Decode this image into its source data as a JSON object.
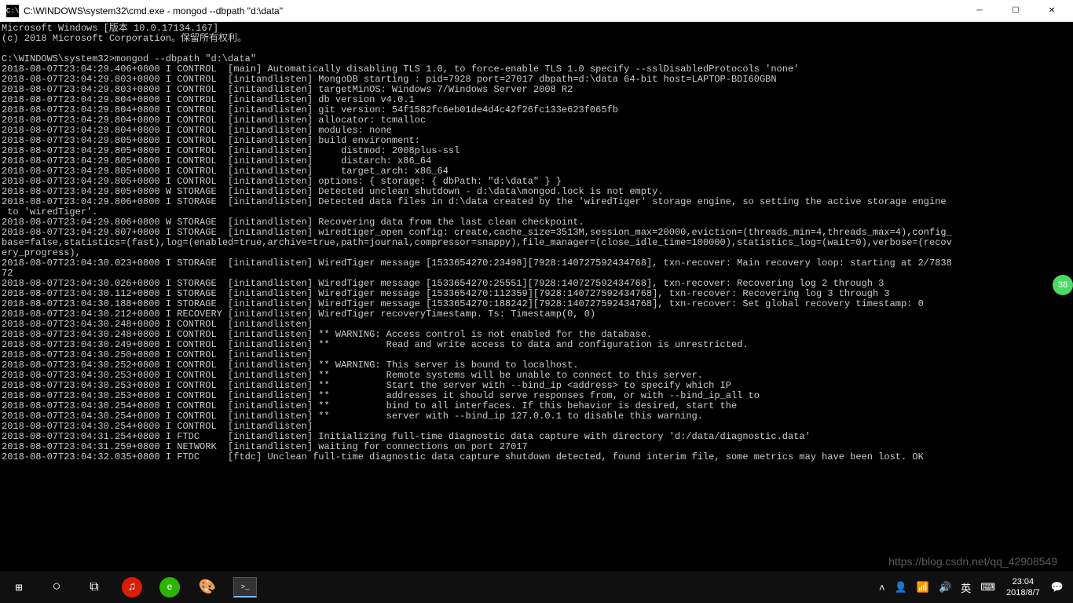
{
  "title": "C:\\WINDOWS\\system32\\cmd.exe - mongod  --dbpath \"d:\\data\"",
  "titlebar_icon": "C:\\",
  "header": [
    "Microsoft Windows [版本 10.0.17134.167]",
    "(c) 2018 Microsoft Corporation。保留所有权利。"
  ],
  "prompt": "C:\\WINDOWS\\system32>mongod --dbpath \"d:\\data\"",
  "log_lines": [
    "2018-08-07T23:04:29.406+0800 I CONTROL  [main] Automatically disabling TLS 1.0, to force-enable TLS 1.0 specify --sslDisabledProtocols 'none'",
    "2018-08-07T23:04:29.803+0800 I CONTROL  [initandlisten] MongoDB starting : pid=7928 port=27017 dbpath=d:\\data 64-bit host=LAPTOP-BDI60GBN",
    "2018-08-07T23:04:29.803+0800 I CONTROL  [initandlisten] targetMinOS: Windows 7/Windows Server 2008 R2",
    "2018-08-07T23:04:29.804+0800 I CONTROL  [initandlisten] db version v4.0.1",
    "2018-08-07T23:04:29.804+0800 I CONTROL  [initandlisten] git version: 54f1582fc6eb01de4d4c42f26fc133e623f065fb",
    "2018-08-07T23:04:29.804+0800 I CONTROL  [initandlisten] allocator: tcmalloc",
    "2018-08-07T23:04:29.804+0800 I CONTROL  [initandlisten] modules: none",
    "2018-08-07T23:04:29.805+0800 I CONTROL  [initandlisten] build environment:",
    "2018-08-07T23:04:29.805+0800 I CONTROL  [initandlisten]     distmod: 2008plus-ssl",
    "2018-08-07T23:04:29.805+0800 I CONTROL  [initandlisten]     distarch: x86_64",
    "2018-08-07T23:04:29.805+0800 I CONTROL  [initandlisten]     target_arch: x86_64",
    "2018-08-07T23:04:29.805+0800 I CONTROL  [initandlisten] options: { storage: { dbPath: \"d:\\data\" } }",
    "2018-08-07T23:04:29.805+0800 W STORAGE  [initandlisten] Detected unclean shutdown - d:\\data\\mongod.lock is not empty.",
    "2018-08-07T23:04:29.806+0800 I STORAGE  [initandlisten] Detected data files in d:\\data created by the 'wiredTiger' storage engine, so setting the active storage engine",
    " to 'wiredTiger'.",
    "2018-08-07T23:04:29.806+0800 W STORAGE  [initandlisten] Recovering data from the last clean checkpoint.",
    "2018-08-07T23:04:29.807+0800 I STORAGE  [initandlisten] wiredtiger_open config: create,cache_size=3513M,session_max=20000,eviction=(threads_min=4,threads_max=4),config_",
    "base=false,statistics=(fast),log=(enabled=true,archive=true,path=journal,compressor=snappy),file_manager=(close_idle_time=100000),statistics_log=(wait=0),verbose=(recov",
    "ery_progress),",
    "2018-08-07T23:04:30.023+0800 I STORAGE  [initandlisten] WiredTiger message [1533654270:23498][7928:140727592434768], txn-recover: Main recovery loop: starting at 2/7838",
    "72",
    "2018-08-07T23:04:30.026+0800 I STORAGE  [initandlisten] WiredTiger message [1533654270:25551][7928:140727592434768], txn-recover: Recovering log 2 through 3",
    "2018-08-07T23:04:30.112+0800 I STORAGE  [initandlisten] WiredTiger message [1533654270:112359][7928:140727592434768], txn-recover: Recovering log 3 through 3",
    "2018-08-07T23:04:30.188+0800 I STORAGE  [initandlisten] WiredTiger message [1533654270:188242][7928:140727592434768], txn-recover: Set global recovery timestamp: 0",
    "2018-08-07T23:04:30.212+0800 I RECOVERY [initandlisten] WiredTiger recoveryTimestamp. Ts: Timestamp(0, 0)",
    "2018-08-07T23:04:30.248+0800 I CONTROL  [initandlisten]",
    "2018-08-07T23:04:30.248+0800 I CONTROL  [initandlisten] ** WARNING: Access control is not enabled for the database.",
    "2018-08-07T23:04:30.249+0800 I CONTROL  [initandlisten] **          Read and write access to data and configuration is unrestricted.",
    "2018-08-07T23:04:30.250+0800 I CONTROL  [initandlisten]",
    "2018-08-07T23:04:30.252+0800 I CONTROL  [initandlisten] ** WARNING: This server is bound to localhost.",
    "2018-08-07T23:04:30.253+0800 I CONTROL  [initandlisten] **          Remote systems will be unable to connect to this server.",
    "2018-08-07T23:04:30.253+0800 I CONTROL  [initandlisten] **          Start the server with --bind_ip <address> to specify which IP",
    "2018-08-07T23:04:30.253+0800 I CONTROL  [initandlisten] **          addresses it should serve responses from, or with --bind_ip_all to",
    "2018-08-07T23:04:30.254+0800 I CONTROL  [initandlisten] **          bind to all interfaces. If this behavior is desired, start the",
    "2018-08-07T23:04:30.254+0800 I CONTROL  [initandlisten] **          server with --bind_ip 127.0.0.1 to disable this warning.",
    "2018-08-07T23:04:30.254+0800 I CONTROL  [initandlisten]",
    "2018-08-07T23:04:31.254+0800 I FTDC     [initandlisten] Initializing full-time diagnostic data capture with directory 'd:/data/diagnostic.data'",
    "2018-08-07T23:04:31.259+0800 I NETWORK  [initandlisten] waiting for connections on port 27017",
    "2018-08-07T23:04:32.035+0800 I FTDC     [ftdc] Unclean full-time diagnostic data capture shutdown detected, found interim file, some metrics may have been lost. OK"
  ],
  "taskbar": {
    "start": "⊞",
    "cortana": "○",
    "taskview": "⧉",
    "netease": "♫",
    "browser": "e",
    "paint": "🎨",
    "cmd": ">_"
  },
  "tray": {
    "up": "˄",
    "people": "👤",
    "wifi": "📶",
    "vol": "🔊",
    "ime": "英",
    "keyb": "⌨",
    "time": "23:04",
    "date": "2018/8/7",
    "action": "💬"
  },
  "watermark": "https://blog.csdn.net/qq_42908549",
  "badge": "38"
}
